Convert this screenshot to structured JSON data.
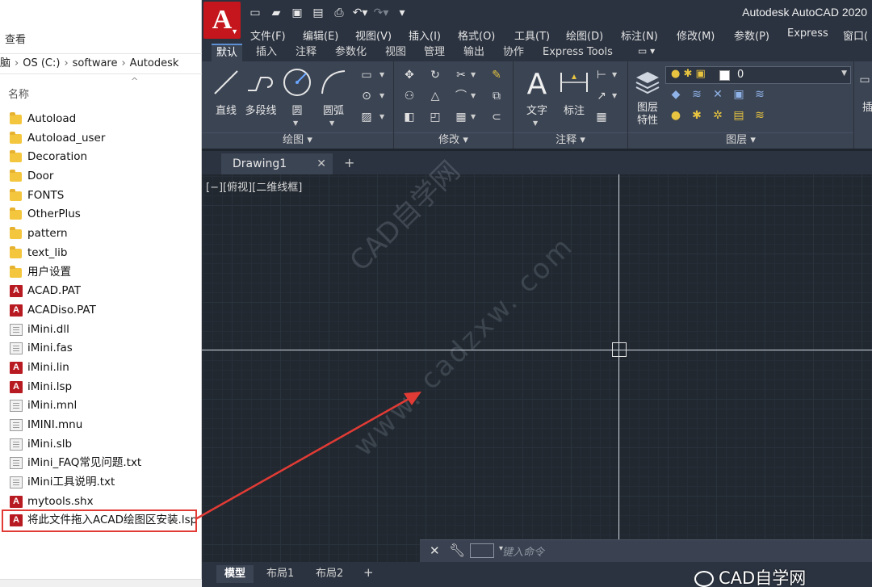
{
  "explorer": {
    "view_label": "查看",
    "address": [
      "脑",
      "OS (C:)",
      "software",
      "Autodesk"
    ],
    "column_name": "名称",
    "files": [
      {
        "name": "Autoload",
        "icon": "folder-icon"
      },
      {
        "name": "Autoload_user",
        "icon": "folder-icon"
      },
      {
        "name": "Decoration",
        "icon": "folder-icon"
      },
      {
        "name": "Door",
        "icon": "folder-icon"
      },
      {
        "name": "FONTS",
        "icon": "folder-icon"
      },
      {
        "name": "OtherPlus",
        "icon": "folder-icon"
      },
      {
        "name": "pattern",
        "icon": "folder-icon"
      },
      {
        "name": "text_lib",
        "icon": "folder-icon"
      },
      {
        "name": "用户设置",
        "icon": "folder-icon"
      },
      {
        "name": "ACAD.PAT",
        "icon": "autocad-file-icon"
      },
      {
        "name": "ACADiso.PAT",
        "icon": "autocad-file-icon"
      },
      {
        "name": "iMini.dll",
        "icon": "document-icon"
      },
      {
        "name": "iMini.fas",
        "icon": "document-icon"
      },
      {
        "name": "iMini.lin",
        "icon": "autocad-file-icon"
      },
      {
        "name": "iMini.lsp",
        "icon": "autocad-file-icon"
      },
      {
        "name": "iMini.mnl",
        "icon": "document-icon"
      },
      {
        "name": "IMINI.mnu",
        "icon": "document-icon"
      },
      {
        "name": "iMini.slb",
        "icon": "document-icon"
      },
      {
        "name": "iMini_FAQ常见问题.txt",
        "icon": "document-icon"
      },
      {
        "name": "iMini工具说明.txt",
        "icon": "document-icon"
      },
      {
        "name": "mytools.shx",
        "icon": "autocad-file-icon"
      },
      {
        "name": "将此文件拖入ACAD绘图区安装.lsp",
        "icon": "autocad-file-icon",
        "highlighted": true
      }
    ]
  },
  "acad": {
    "app_letter": "A",
    "title": "Autodesk AutoCAD 2020",
    "menus": [
      "文件(F)",
      "编辑(E)",
      "视图(V)",
      "插入(I)",
      "格式(O)",
      "工具(T)",
      "绘图(D)",
      "标注(N)",
      "修改(M)",
      "参数(P)",
      "Express",
      "窗口("
    ],
    "ribbon_tabs": [
      "默认",
      "插入",
      "注释",
      "参数化",
      "视图",
      "管理",
      "输出",
      "协作",
      "Express Tools"
    ],
    "active_tab": "默认",
    "tools": {
      "line": "直线",
      "polyline": "多段线",
      "circle": "圆",
      "arc": "圆弧",
      "text": "文字",
      "dimension": "标注",
      "layer_props": "图层\n特性"
    },
    "panels": {
      "draw": "绘图",
      "modify": "修改",
      "annotation": "注释",
      "layers": "图层",
      "insert": "插"
    },
    "layer_current": "0",
    "document_tab": "Drawing1",
    "viewport_label": "[−][俯视][二维线框]",
    "command_placeholder": "键入命令",
    "layout_tabs": [
      "模型",
      "布局1",
      "布局2"
    ],
    "active_layout": "模型"
  },
  "watermark": {
    "line1": "CAD自学网",
    "line2": "www. cadzxw. com",
    "brand": "CAD自学网"
  },
  "colors": {
    "annotation_red": "#e23b35",
    "autocad_red": "#c4161c",
    "canvas_bg": "#212830"
  }
}
